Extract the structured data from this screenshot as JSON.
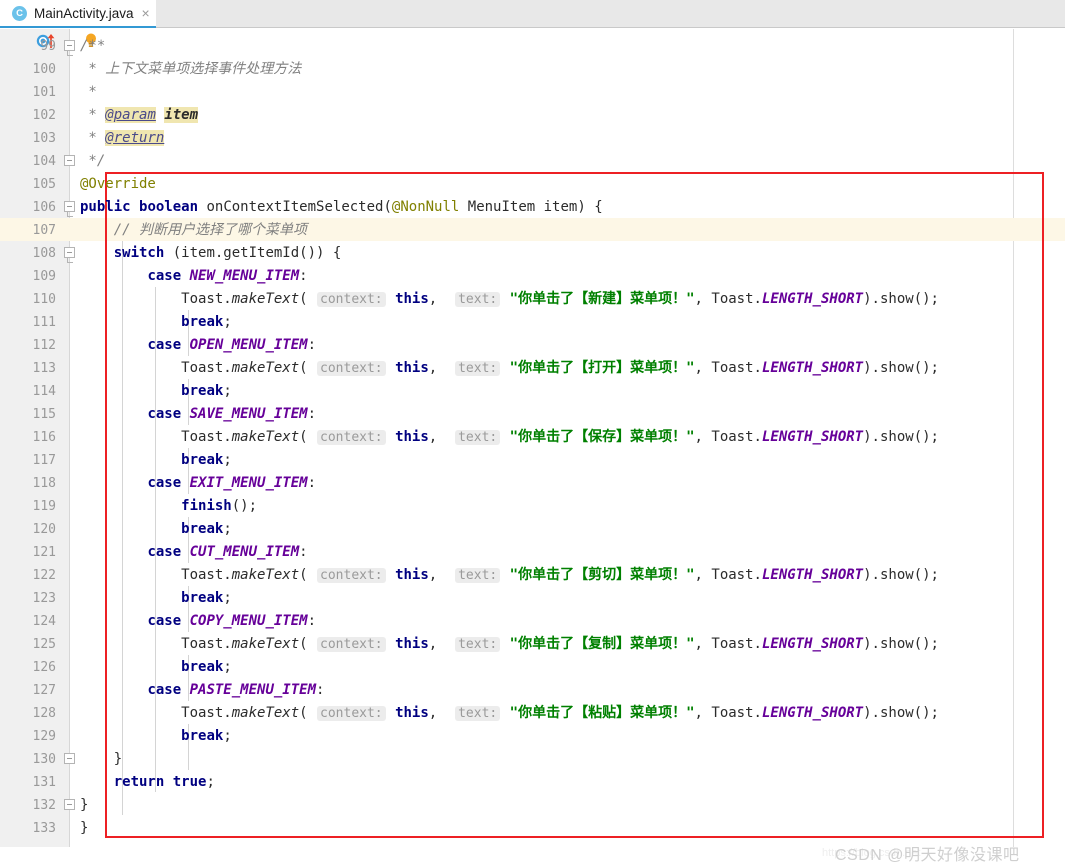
{
  "tab": {
    "icon": "java-class-icon",
    "label": "MainActivity.java",
    "close": "×"
  },
  "editor": {
    "current_line": 107,
    "gutter_icons": {
      "override_marker": "override-method-icon",
      "intention_bulb": "intention-bulb-icon"
    },
    "annotation_box_color": "#ed2024",
    "colors": {
      "keyword": "#000080",
      "string": "#008000",
      "constant": "#660099",
      "comment": "#808080",
      "annotation": "#808000",
      "parameter_hint": "#9a9a9a",
      "current_line_bg": "#fdf7e6",
      "gutter_bg": "#f0f0f0",
      "tab_underline": "#3399d4"
    },
    "lines": [
      {
        "no": 99,
        "fold": "start",
        "text": "/**"
      },
      {
        "no": 100,
        "text": " * 上下文菜单项选择事件处理方法"
      },
      {
        "no": 101,
        "text": " *"
      },
      {
        "no": 102,
        "text": " * @param item"
      },
      {
        "no": 103,
        "text": " * @return"
      },
      {
        "no": 104,
        "fold": "end",
        "text": " */"
      },
      {
        "no": 105,
        "text": "@Override"
      },
      {
        "no": 106,
        "fold": "start",
        "text": "public boolean onContextItemSelected(@NonNull MenuItem item) {"
      },
      {
        "no": 107,
        "text": "    // 判断用户选择了哪个菜单项"
      },
      {
        "no": 108,
        "fold": "start",
        "text": "    switch (item.getItemId()) {"
      },
      {
        "no": 109,
        "text": "        case NEW_MENU_ITEM:"
      },
      {
        "no": 110,
        "text": "            Toast.makeText( context: this,  text: \"你单击了【新建】菜单项！\", Toast.LENGTH_SHORT).show();"
      },
      {
        "no": 111,
        "text": "            break;"
      },
      {
        "no": 112,
        "text": "        case OPEN_MENU_ITEM:"
      },
      {
        "no": 113,
        "text": "            Toast.makeText( context: this,  text: \"你单击了【打开】菜单项！\", Toast.LENGTH_SHORT).show();"
      },
      {
        "no": 114,
        "text": "            break;"
      },
      {
        "no": 115,
        "text": "        case SAVE_MENU_ITEM:"
      },
      {
        "no": 116,
        "text": "            Toast.makeText( context: this,  text: \"你单击了【保存】菜单项！\", Toast.LENGTH_SHORT).show();"
      },
      {
        "no": 117,
        "text": "            break;"
      },
      {
        "no": 118,
        "text": "        case EXIT_MENU_ITEM:"
      },
      {
        "no": 119,
        "text": "            finish();"
      },
      {
        "no": 120,
        "text": "            break;"
      },
      {
        "no": 121,
        "text": "        case CUT_MENU_ITEM:"
      },
      {
        "no": 122,
        "text": "            Toast.makeText( context: this,  text: \"你单击了【剪切】菜单项！\", Toast.LENGTH_SHORT).show();"
      },
      {
        "no": 123,
        "text": "            break;"
      },
      {
        "no": 124,
        "text": "        case COPY_MENU_ITEM:"
      },
      {
        "no": 125,
        "text": "            Toast.makeText( context: this,  text: \"你单击了【复制】菜单项！\", Toast.LENGTH_SHORT).show();"
      },
      {
        "no": 126,
        "text": "            break;"
      },
      {
        "no": 127,
        "text": "        case PASTE_MENU_ITEM:"
      },
      {
        "no": 128,
        "text": "            Toast.makeText( context: this,  text: \"你单击了【粘贴】菜单项！\", Toast.LENGTH_SHORT).show();"
      },
      {
        "no": 129,
        "text": "            break;"
      },
      {
        "no": 130,
        "fold": "end",
        "text": "    }"
      },
      {
        "no": 131,
        "text": "    return true;"
      },
      {
        "no": 132,
        "fold": "end",
        "text": "}"
      },
      {
        "no": 133,
        "text": "}"
      }
    ]
  },
  "watermark": {
    "text": "CSDN @明天好像没课吧",
    "url": "https://blog.csdn.net"
  }
}
